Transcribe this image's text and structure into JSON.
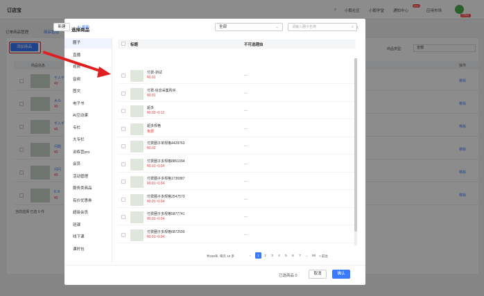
{
  "app": {
    "title": "订店宝"
  },
  "topnav": {
    "items": [
      "小鹅社区",
      "小鹅学堂",
      "通知中心",
      "应用市场"
    ],
    "badge": "99+",
    "version_tag": "已购买"
  },
  "bg_tabs": [
    "订单商品管理",
    "商品管理"
  ],
  "bg_page": {
    "add_button": "添加商品",
    "filter_label": "商品类型:",
    "filter_value": "全部",
    "col_goods": "商品信息",
    "col_op": "操作",
    "op_label": "移除",
    "bottom": "当前选择  已选 0 件",
    "rows": [
      {
        "name": "千人千面",
        "price": "¥0"
      },
      {
        "name": "大众",
        "price": "¥0"
      },
      {
        "name": "千人千面",
        "price": "¥0"
      },
      {
        "name": "问题",
        "price": "¥0"
      },
      {
        "name": "问问",
        "price": "¥0"
      },
      {
        "name": "E.N",
        "price": "¥0"
      }
    ]
  },
  "modal": {
    "title": "选择商品",
    "close": "×",
    "sidebar": [
      "圈子",
      "直播",
      "视频",
      "音频",
      "图文",
      "电子书",
      "AI互动课",
      "专栏",
      "大专栏",
      "训练营pro",
      "会员",
      "活动管理",
      "服务类商品",
      "有价优惠券",
      "超级会员",
      "班课",
      "线下课",
      "课时包"
    ],
    "active_index": 0,
    "new_btn": "新建",
    "refresh_btn": "刷新",
    "filter_value": "全部",
    "search_placeholder": "请输入圈子名称",
    "col_title": "标题",
    "col_reason": "不可选理由",
    "rows": [
      {
        "name": "付费-测试",
        "price": "¥0.01",
        "reason": "---"
      },
      {
        "name": "付费-信息采集购买",
        "price": "¥0.01",
        "reason": "---"
      },
      {
        "name": "超多",
        "price": "¥0.02~0.12",
        "reason": "---"
      },
      {
        "name": "超多规格",
        "price": "免费",
        "reason": "---"
      },
      {
        "name": "付费圈子单规格4428763",
        "price": "¥0.02",
        "reason": "---"
      },
      {
        "name": "付费圈子多规格8851094",
        "price": "¥0.01~0.04",
        "reason": "---"
      },
      {
        "name": "付费圈子多规格1736987",
        "price": "¥0.01~0.04",
        "reason": "---"
      },
      {
        "name": "付费圈子多规格2547573",
        "price": "¥0.01~0.04",
        "reason": "---"
      },
      {
        "name": "付费圈子多规格5877741",
        "price": "¥0.01~0.04",
        "reason": "---"
      },
      {
        "name": "付费圈子多规格6872599",
        "price": "¥0.01~0.04",
        "reason": "---"
      }
    ],
    "pager": {
      "total": "共336条, 每页 10 条",
      "pages": [
        "1",
        "2",
        "3",
        "4",
        "5",
        "6",
        "7",
        "...",
        "68"
      ],
      "goto": "> 前往"
    },
    "chosen": "已选商品 0",
    "cancel": "取消",
    "ok": "确认"
  },
  "colors": {
    "accent": "#3a7afe",
    "highlight": "#e02020"
  }
}
